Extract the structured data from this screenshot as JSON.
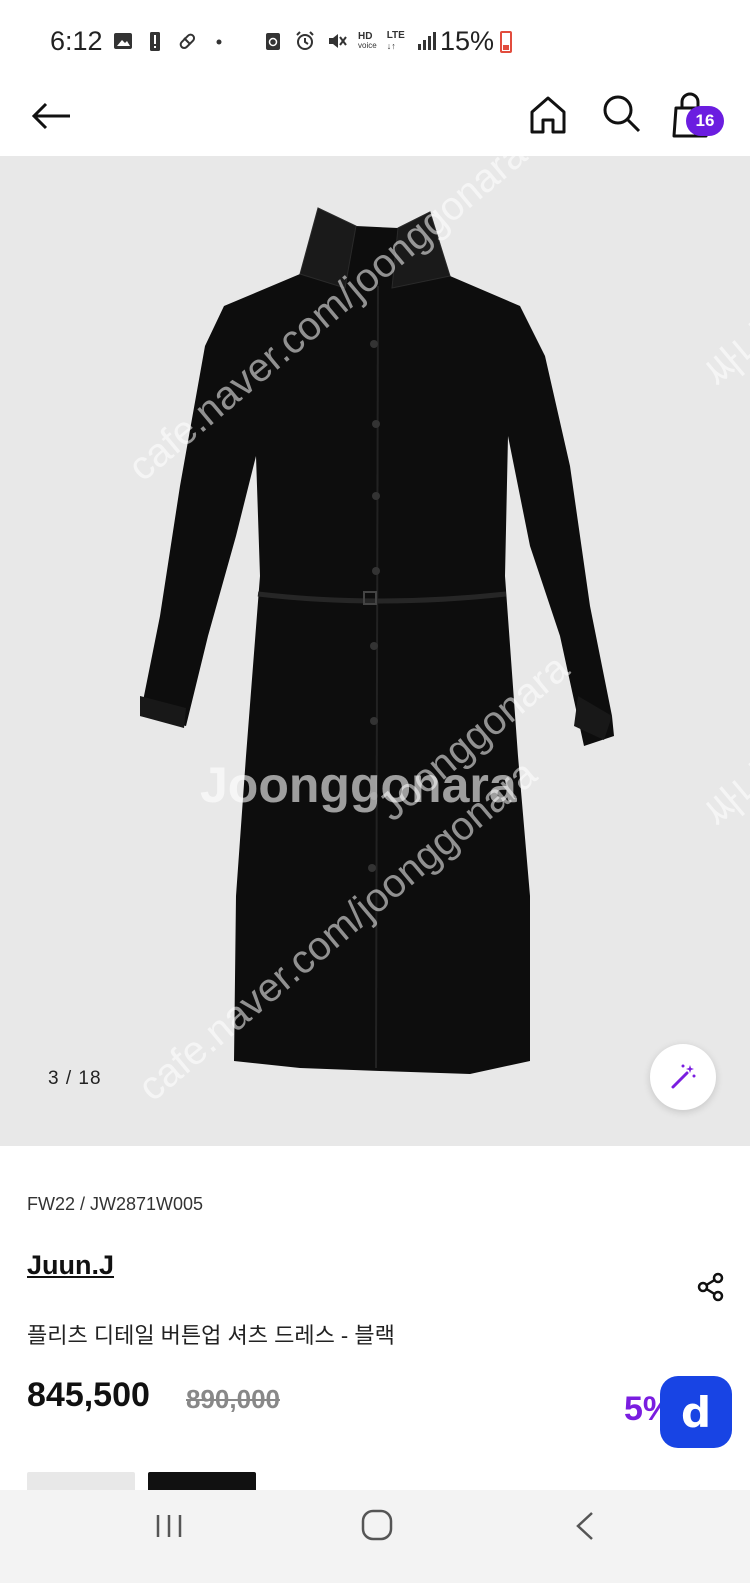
{
  "status_bar": {
    "time": "6:12",
    "battery_text": "15%",
    "left_icons": [
      "image-icon",
      "battery-alert-icon",
      "pill-icon",
      "dot-icon"
    ],
    "right_icons": [
      "recycle-icon",
      "alarm-icon",
      "mute-icon",
      "hd-voice-icon",
      "lte-icon",
      "signal-icon"
    ],
    "hd_label": "HD",
    "voice_label": "voice",
    "lte_label": "LTE"
  },
  "header": {
    "cart_count": "16",
    "accent_color": "#6b1de0"
  },
  "gallery": {
    "page_indicator": "3 / 18",
    "watermark_url": "cafe.naver.com/joonggonara",
    "watermark_brand": "Joonggonara",
    "watermark_side": "싸니"
  },
  "product": {
    "code": "FW22 / JW2871W005",
    "brand": "Juun.J",
    "title": "플리츠 디테일 버튼업 셔츠 드레스 - 블랙",
    "sale_price": "845,500",
    "original_price": "890,000",
    "discount": "5%",
    "discount_color": "#7a1de0"
  },
  "fab": {
    "label": "d",
    "color": "#1844e4"
  }
}
